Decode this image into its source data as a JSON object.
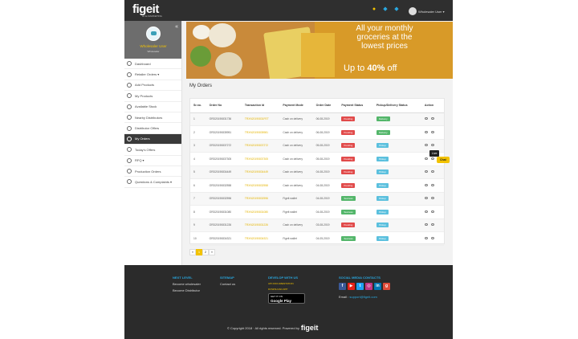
{
  "brand": {
    "logo": "figeit",
    "tagline": "an E-MARKETING",
    "footer_logo": "figeit"
  },
  "topbar": {
    "user_label": "Wholesaler User ▾"
  },
  "sidebar": {
    "user_name": "Wholesaler User",
    "user_role": "Wholesaler",
    "items": [
      {
        "label": "Dashboard",
        "icon": "dashboard-icon"
      },
      {
        "label": "Retailer Orders ▾",
        "icon": "orders-icon"
      },
      {
        "label": "Add Products",
        "icon": "add-icon"
      },
      {
        "label": "My Products",
        "icon": "box-icon"
      },
      {
        "label": "Available Stock",
        "icon": "stock-icon"
      },
      {
        "label": "Nearby Distributors",
        "icon": "location-icon"
      },
      {
        "label": "Distributor Offers",
        "icon": "offer-icon"
      },
      {
        "label": "My Orders",
        "icon": "cart-icon",
        "active": true
      },
      {
        "label": "Today's Offers",
        "icon": "tag-icon"
      },
      {
        "label": "RFQ ▾",
        "icon": "rfq-icon"
      },
      {
        "label": "Production Orders",
        "icon": "factory-icon"
      },
      {
        "label": "Questions & Complaints ▾",
        "icon": "question-icon"
      }
    ]
  },
  "banner": {
    "line1": "All your monthly",
    "line2": "groceries at the",
    "line3": "lowest prices",
    "price_prefix": "Up to",
    "price_value": "40%",
    "price_suffix": "off"
  },
  "page_title": "My Orders",
  "table": {
    "headers": [
      "Sr.no.",
      "Order No",
      "Transaction Id",
      "Payment Mode",
      "Order Date",
      "Payment Status",
      "Pickup/Delivery Status",
      "Action"
    ],
    "rows": [
      [
        "1",
        "ORD20190831736",
        "TRXN20190831FET",
        "Cash on delivery",
        "06-08-2019",
        "Pending",
        "Delivery"
      ],
      [
        "2",
        "ORD20190835951",
        "TRXN20190835981",
        "Cash on delivery",
        "06-08-2019",
        "Pending",
        "Delivery"
      ],
      [
        "3",
        "ORD20190837272",
        "TRXN20190837272",
        "Cash on delivery",
        "05-08-2019",
        "Pending",
        "Pickup"
      ],
      [
        "4",
        "ORD20190837305",
        "TRXN20190837305",
        "Cash on delivery",
        "05-08-2019",
        "Pending",
        "Pickup"
      ],
      [
        "5",
        "ORD20190834449",
        "TRXN20190834449",
        "Cash on delivery",
        "04-08-2019",
        "Pending",
        "Pickup"
      ],
      [
        "6",
        "ORD20190832558",
        "TRXN20190832558",
        "Cash on delivery",
        "04-08-2019",
        "Pending",
        "Pickup"
      ],
      [
        "7",
        "ORD20190832596",
        "TRXN20190832596",
        "Figeit wallet",
        "04-08-2019",
        "Success",
        "Pickup"
      ],
      [
        "8",
        "ORD20190831080",
        "TRXN20190831080",
        "Figeit wallet",
        "04-08-2019",
        "Success",
        "Pickup"
      ],
      [
        "9",
        "ORD20190831226",
        "TRXN20190831226",
        "Cash on delivery",
        "03-08-2019",
        "Pending",
        "Pickup"
      ],
      [
        "10",
        "ORD20190834321",
        "TRXN20190834321",
        "Figeit wallet",
        "04-05-2019",
        "Success",
        "Pickup"
      ]
    ]
  },
  "pagination": {
    "prev": "«",
    "current": "1",
    "next_page": "2",
    "next": "»"
  },
  "floating": {
    "live": "Live",
    "chat": "Chat"
  },
  "footer": {
    "col1_title": "NEXT LEVEL",
    "col1_items": [
      "Become wholesaler",
      "Become Distributor"
    ],
    "col2_title": "SITEMAP",
    "col2_items": [
      "Contact us"
    ],
    "col3_title": "DEVELOP WITH US",
    "col3_line1": "API DOCUMENTATION",
    "col3_line2": "DOWNLOAD APP",
    "play_small": "GET IT ON",
    "play_big": "Google Play",
    "col4_title": "SOCIAL MEDIA CONTACTS",
    "email_label": "Email :",
    "email_value": "support@figeit.com",
    "copyright": "© Copyright 2018 · All rights reserved. Powered by"
  },
  "colors": {
    "accent": "#f2c200",
    "link": "#29a8e0",
    "pending": "#e14a4a",
    "success": "#53b66a",
    "info": "#5bc0de"
  }
}
